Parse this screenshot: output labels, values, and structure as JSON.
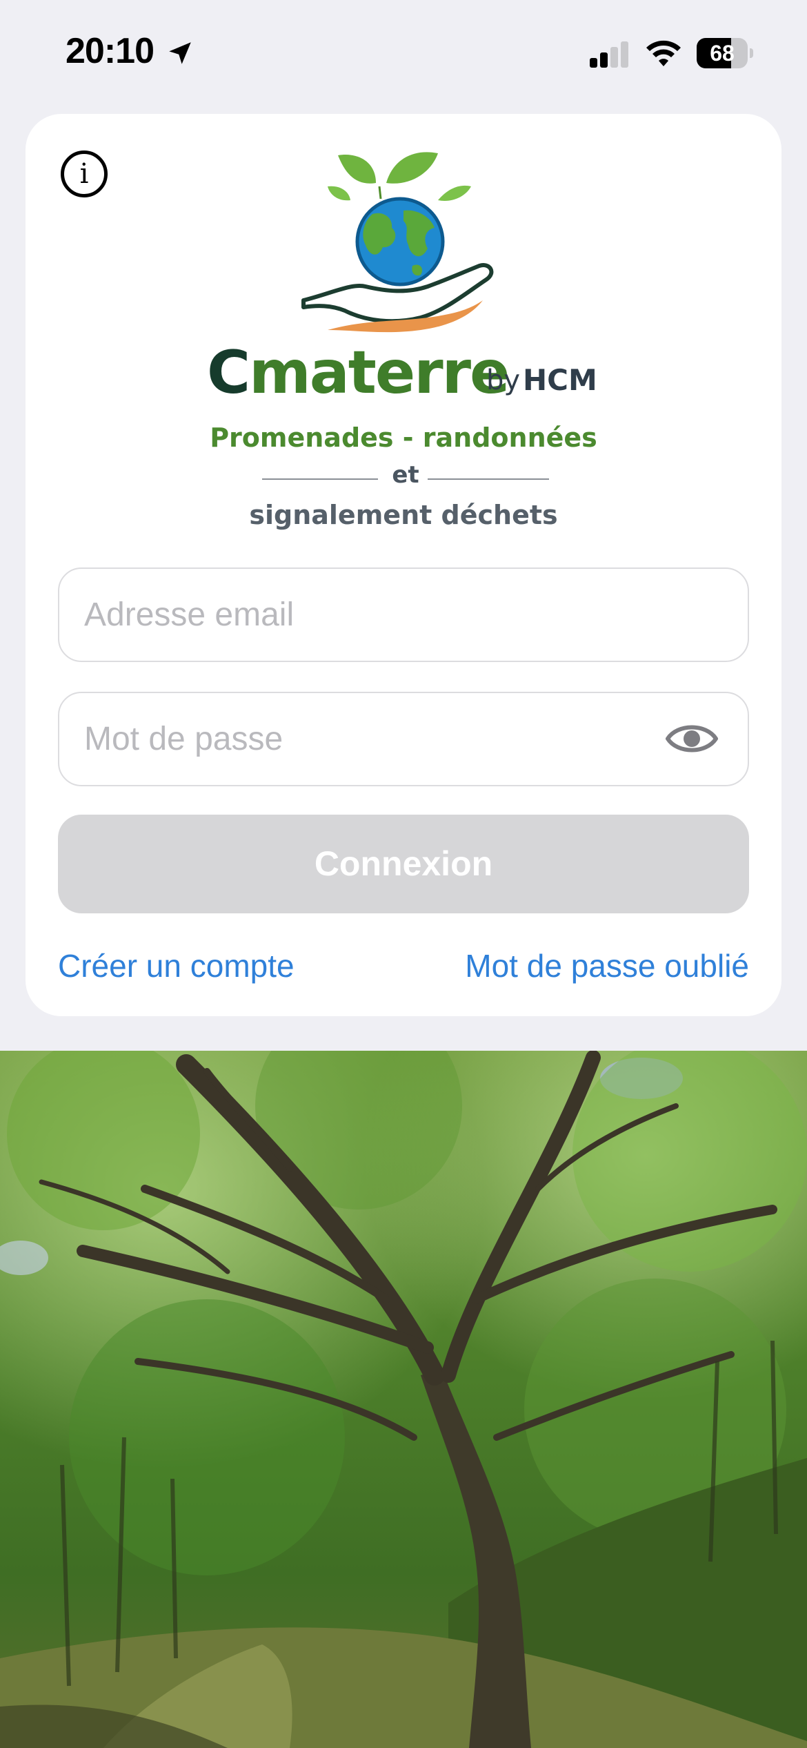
{
  "status_bar": {
    "time": "20:10",
    "battery_percent": "68",
    "battery_level": 0.68,
    "signal_bars_active": 2,
    "signal_bars_total": 4,
    "icons": [
      "location-arrow-icon",
      "cellular-signal-icon",
      "wifi-icon",
      "battery-icon"
    ]
  },
  "header": {
    "info_icon": "info-icon"
  },
  "brand": {
    "name_initial": "C",
    "name_rest": "materre",
    "by": "by",
    "company": "HCM",
    "tagline_1": "Promenades - randonnées",
    "tagline_connector": "et",
    "tagline_2": "signalement déchets"
  },
  "form": {
    "email_placeholder": "Adresse email",
    "email_value": "",
    "password_placeholder": "Mot de passe",
    "password_value": "",
    "password_toggle_icon": "eye-icon",
    "login_label": "Connexion",
    "create_account_label": "Créer un compte",
    "forgot_password_label": "Mot de passe oublié"
  },
  "colors": {
    "background": "#efeff4",
    "card": "#ffffff",
    "brand_green": "#3f7d2a",
    "brand_dark": "#163b2c",
    "link_blue": "#2f80d9",
    "button_disabled": "#d6d6d8"
  }
}
